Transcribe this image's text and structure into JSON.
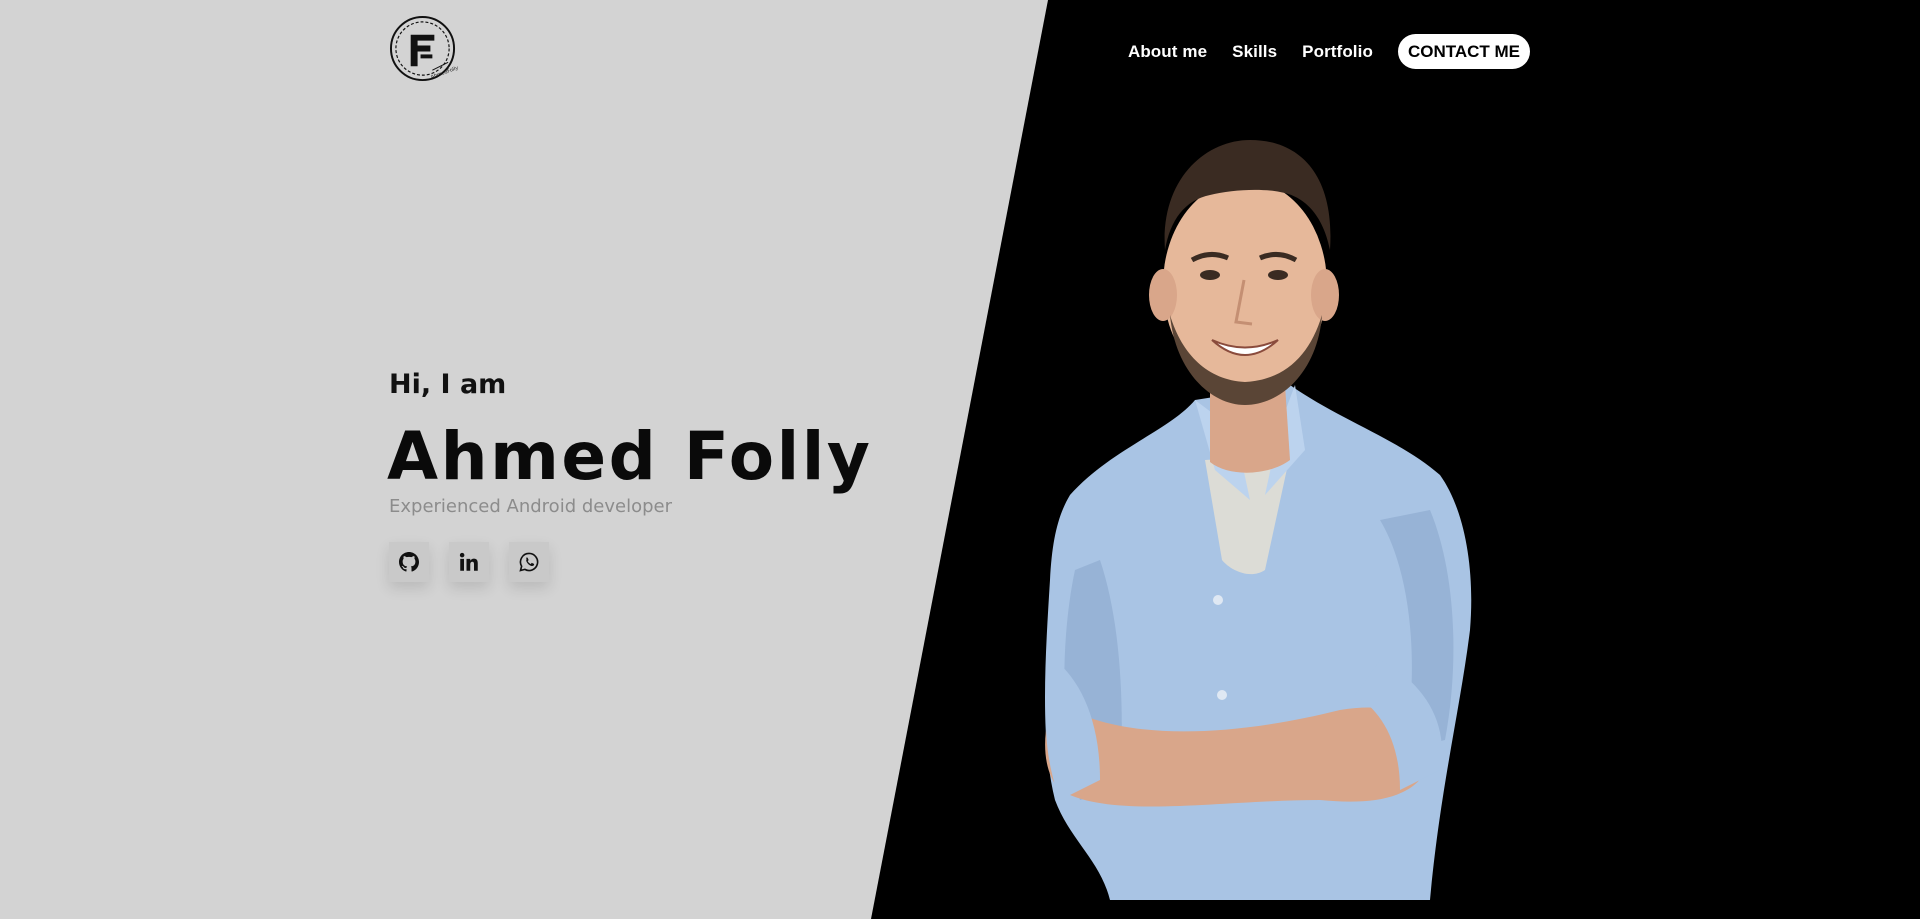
{
  "nav": {
    "items": [
      {
        "label": "About me"
      },
      {
        "label": "Skills"
      },
      {
        "label": "Portfolio"
      }
    ],
    "contact_label": "CONTACT ME"
  },
  "logo": {
    "icon": "af-monogram-logo",
    "text": "AhmedFolly"
  },
  "hero": {
    "greeting": "Hi, I am",
    "name": "Ahmed Folly",
    "subtitle": "Experienced Android developer"
  },
  "socials": [
    {
      "icon": "github-icon"
    },
    {
      "icon": "linkedin-icon"
    },
    {
      "icon": "whatsapp-icon"
    }
  ],
  "colors": {
    "light_bg": "#d3d3d3",
    "dark_bg": "#000000",
    "shirt": "#a9c4e4",
    "text_muted": "#8c8c8c"
  }
}
